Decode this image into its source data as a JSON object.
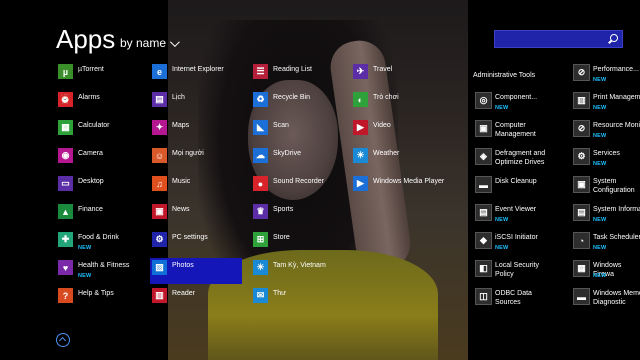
{
  "header": {
    "title": "Apps",
    "sort_label": "by name"
  },
  "search": {
    "placeholder": ""
  },
  "colors": {
    "accent": "#1416b8",
    "new_badge": "#1ec0ff"
  },
  "columns": [
    {
      "items": [
        {
          "label": "µTorrent",
          "badge": "",
          "icon": "utorrent-icon",
          "bg": "#3a8f2a",
          "glyph": "µ"
        },
        {
          "label": "Alarms",
          "badge": "",
          "icon": "alarm-clock-icon",
          "bg": "#d8232a",
          "glyph": "⏰"
        },
        {
          "label": "Calculator",
          "badge": "",
          "icon": "calculator-icon",
          "bg": "#2ea13a",
          "glyph": "▦"
        },
        {
          "label": "Camera",
          "badge": "",
          "icon": "camera-icon",
          "bg": "#b4178f",
          "glyph": "◉"
        },
        {
          "label": "Desktop",
          "badge": "",
          "icon": "desktop-icon",
          "bg": "#5b2ea8",
          "glyph": "▭"
        },
        {
          "label": "Finance",
          "badge": "",
          "icon": "finance-chart-icon",
          "bg": "#1a8a3c",
          "glyph": "▲"
        },
        {
          "label": "Food & Drink",
          "badge": "NEW",
          "icon": "food-drink-icon",
          "bg": "#23a57a",
          "glyph": "✚"
        },
        {
          "label": "Health & Fitness",
          "badge": "NEW",
          "icon": "heart-icon",
          "bg": "#7a2aa8",
          "glyph": "♥"
        },
        {
          "label": "Help & Tips",
          "badge": "",
          "icon": "help-icon",
          "bg": "#d84a1f",
          "glyph": "?"
        }
      ]
    },
    {
      "items": [
        {
          "label": "Internet Explorer",
          "badge": "",
          "icon": "internet-explorer-icon",
          "bg": "#1b6fd6",
          "glyph": "e"
        },
        {
          "label": "Lịch",
          "badge": "",
          "icon": "calendar-icon",
          "bg": "#5b2ea8",
          "glyph": "▤"
        },
        {
          "label": "Maps",
          "badge": "",
          "icon": "maps-icon",
          "bg": "#b4178f",
          "glyph": "✦"
        },
        {
          "label": "Mọi người",
          "badge": "",
          "icon": "people-icon",
          "bg": "#d8592a",
          "glyph": "☺"
        },
        {
          "label": "Music",
          "badge": "",
          "icon": "headphones-icon",
          "bg": "#e0501e",
          "glyph": "♫"
        },
        {
          "label": "News",
          "badge": "",
          "icon": "news-icon",
          "bg": "#c0182a",
          "glyph": "▣"
        },
        {
          "label": "PC settings",
          "badge": "",
          "icon": "gear-icon",
          "bg": "#1f24a8",
          "glyph": "⚙"
        },
        {
          "label": "Photos",
          "badge": "",
          "icon": "photos-icon",
          "bg": "#0f6fd6",
          "glyph": "▨",
          "selected": true
        },
        {
          "label": "Reader",
          "badge": "",
          "icon": "reader-icon",
          "bg": "#c0182a",
          "glyph": "▥"
        }
      ]
    },
    {
      "items": [
        {
          "label": "Reading List",
          "badge": "",
          "icon": "reading-list-icon",
          "bg": "#b51f3a",
          "glyph": "☰"
        },
        {
          "label": "Recycle Bin",
          "badge": "",
          "icon": "recycle-bin-icon",
          "bg": "#1b6fd6",
          "glyph": "♻"
        },
        {
          "label": "Scan",
          "badge": "",
          "icon": "scan-icon",
          "bg": "#1b6fd6",
          "glyph": "◣"
        },
        {
          "label": "SkyDrive",
          "badge": "",
          "icon": "cloud-icon",
          "bg": "#1b6fd6",
          "glyph": "☁"
        },
        {
          "label": "Sound Recorder",
          "badge": "",
          "icon": "microphone-icon",
          "bg": "#d8232a",
          "glyph": "●"
        },
        {
          "label": "Sports",
          "badge": "",
          "icon": "trophy-icon",
          "bg": "#5b2ea8",
          "glyph": "♛"
        },
        {
          "label": "Store",
          "badge": "",
          "icon": "store-icon",
          "bg": "#2ea13a",
          "glyph": "⊞"
        },
        {
          "label": "Tam Kỳ, Vietnam",
          "badge": "",
          "icon": "weather-sun-icon",
          "bg": "#1b8ad6",
          "glyph": "☀"
        },
        {
          "label": "Thư",
          "badge": "",
          "icon": "mail-icon",
          "bg": "#1b8ad6",
          "glyph": "✉"
        }
      ]
    },
    {
      "items": [
        {
          "label": "Travel",
          "badge": "",
          "icon": "travel-icon",
          "bg": "#5b2ea8",
          "glyph": "✈"
        },
        {
          "label": "Trò chơi",
          "badge": "",
          "icon": "game-controller-icon",
          "bg": "#2ea13a",
          "glyph": "◐"
        },
        {
          "label": "Video",
          "badge": "",
          "icon": "video-icon",
          "bg": "#c0182a",
          "glyph": "▶"
        },
        {
          "label": "Weather",
          "badge": "",
          "icon": "weather-sun-icon",
          "bg": "#1b8ad6",
          "glyph": "☀"
        },
        {
          "label": "Windows Media Player",
          "badge": "",
          "icon": "media-player-icon",
          "bg": "#1b6fd6",
          "glyph": "▶"
        }
      ]
    }
  ],
  "admin_tools": {
    "header": "Administrative Tools",
    "columns": [
      {
        "items": [
          {
            "label": "Component...",
            "badge": "NEW",
            "icon": "component-services-icon",
            "glyph": "◎"
          },
          {
            "label": "Computer Management",
            "badge": "",
            "icon": "computer-management-icon",
            "glyph": "▣"
          },
          {
            "label": "Defragment and Optimize Drives",
            "badge": "",
            "icon": "defragment-icon",
            "glyph": "◈"
          },
          {
            "label": "Disk Cleanup",
            "badge": "",
            "icon": "disk-cleanup-icon",
            "glyph": "▬"
          },
          {
            "label": "Event Viewer",
            "badge": "NEW",
            "icon": "event-viewer-icon",
            "glyph": "▤"
          },
          {
            "label": "iSCSI Initiator",
            "badge": "NEW",
            "icon": "iscsi-icon",
            "glyph": "◆"
          },
          {
            "label": "Local Security Policy",
            "badge": "",
            "icon": "security-policy-icon",
            "glyph": "◧"
          },
          {
            "label": "ODBC Data Sources",
            "badge": "",
            "icon": "odbc-icon",
            "glyph": "◫"
          }
        ]
      },
      {
        "items": [
          {
            "label": "Performance...",
            "badge": "NEW",
            "icon": "performance-monitor-icon",
            "glyph": "⊘"
          },
          {
            "label": "Print Managem",
            "badge": "NEW",
            "icon": "printer-icon",
            "glyph": "▥"
          },
          {
            "label": "Resource Moni",
            "badge": "NEW",
            "icon": "resource-monitor-icon",
            "glyph": "⊘"
          },
          {
            "label": "Services",
            "badge": "NEW",
            "icon": "services-gear-icon",
            "glyph": "⚙"
          },
          {
            "label": "System Configuration",
            "badge": "",
            "icon": "system-config-icon",
            "glyph": "▣"
          },
          {
            "label": "System Informa",
            "badge": "NEW",
            "icon": "system-info-icon",
            "glyph": "▤"
          },
          {
            "label": "Task Scheduler",
            "badge": "NEW",
            "icon": "task-scheduler-icon",
            "glyph": "◔"
          },
          {
            "label": "Windows Firewa",
            "badge": "NEW",
            "icon": "firewall-icon",
            "glyph": "▦"
          },
          {
            "label": "Windows Memo Diagnostic",
            "badge": "",
            "icon": "memory-diagnostic-icon",
            "glyph": "▬"
          }
        ]
      }
    ]
  }
}
